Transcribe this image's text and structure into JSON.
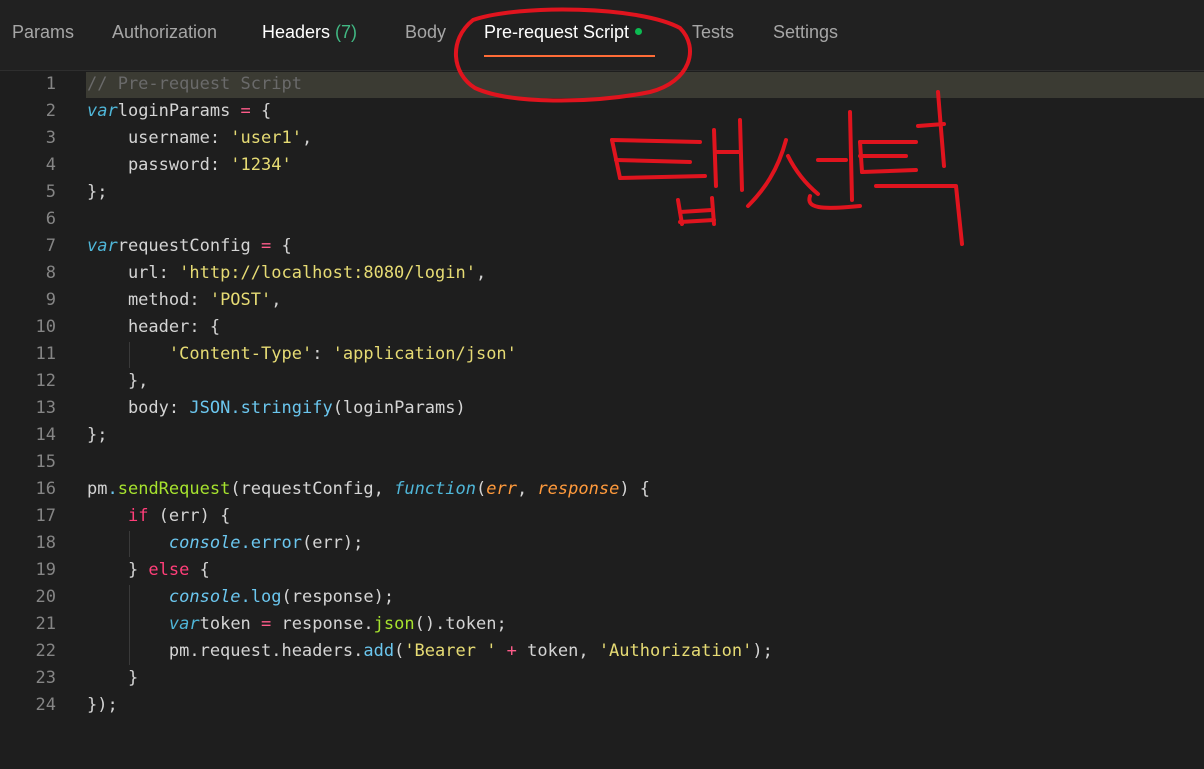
{
  "tabs": [
    {
      "label": "Params",
      "count": "",
      "dot": false,
      "active": false
    },
    {
      "label": "Authorization",
      "count": "",
      "dot": false,
      "active": false
    },
    {
      "label": "Headers ",
      "count": "(7)",
      "dot": false,
      "active": false
    },
    {
      "label": "Body",
      "count": "",
      "dot": false,
      "active": false
    },
    {
      "label": "Pre-request Script",
      "count": "",
      "dot": true,
      "active": true
    },
    {
      "label": "Tests",
      "count": "",
      "dot": false,
      "active": false
    },
    {
      "label": "Settings",
      "count": "",
      "dot": false,
      "active": false
    }
  ],
  "accent_color": "#ff6c37",
  "status_dot_color": "#0cbb52",
  "line_numbers": [
    "1",
    "2",
    "3",
    "4",
    "5",
    "6",
    "7",
    "8",
    "9",
    "10",
    "11",
    "12",
    "13",
    "14",
    "15",
    "16",
    "17",
    "18",
    "19",
    "20",
    "21",
    "22",
    "23",
    "24"
  ],
  "code": [
    [
      [
        "cm",
        "// Pre-request Script"
      ]
    ],
    [
      [
        "kw",
        "var"
      ],
      [
        "",
        "loginParams "
      ],
      [
        "op",
        "="
      ],
      [
        "",
        " {"
      ]
    ],
    [
      [
        "",
        "    username: "
      ],
      [
        "str",
        "'user1'"
      ],
      [
        "",
        ","
      ]
    ],
    [
      [
        "",
        "    password: "
      ],
      [
        "str",
        "'1234'"
      ]
    ],
    [
      [
        "",
        "};"
      ]
    ],
    [],
    [
      [
        "kw",
        "var"
      ],
      [
        "",
        "requestConfig "
      ],
      [
        "op",
        "="
      ],
      [
        "",
        " {"
      ]
    ],
    [
      [
        "",
        "    url: "
      ],
      [
        "str",
        "'http://localhost:8080/login'"
      ],
      [
        "",
        ","
      ]
    ],
    [
      [
        "",
        "    method: "
      ],
      [
        "str",
        "'POST'"
      ],
      [
        "",
        ","
      ]
    ],
    [
      [
        "",
        "    header: {"
      ]
    ],
    [
      [
        "",
        "        "
      ],
      [
        "str",
        "'Content-Type'"
      ],
      [
        "",
        ": "
      ],
      [
        "str",
        "'application/json'"
      ]
    ],
    [
      [
        "",
        "    },"
      ]
    ],
    [
      [
        "",
        "    body: "
      ],
      [
        "ob",
        "JSON"
      ],
      [
        "ob",
        "."
      ],
      [
        "ob",
        "stringify"
      ],
      [
        "",
        "(loginParams)"
      ]
    ],
    [
      [
        "",
        "};"
      ]
    ],
    [],
    [
      [
        "",
        "pm"
      ],
      [
        "ob",
        "."
      ],
      [
        "fn",
        "sendRequest"
      ],
      [
        "",
        "(requestConfig, "
      ],
      [
        "kw",
        "function"
      ],
      [
        "",
        "("
      ],
      [
        "prm",
        "err"
      ],
      [
        "",
        ", "
      ],
      [
        "prm",
        "response"
      ],
      [
        "",
        ") {"
      ]
    ],
    [
      [
        "",
        "    "
      ],
      [
        "ctl",
        "if"
      ],
      [
        "",
        " (err) {"
      ]
    ],
    [
      [
        "",
        "        "
      ],
      [
        "cs",
        "console"
      ],
      [
        "ob",
        ".error"
      ],
      [
        "",
        "(err);"
      ]
    ],
    [
      [
        "",
        "    } "
      ],
      [
        "ctl",
        "else"
      ],
      [
        "",
        " {"
      ]
    ],
    [
      [
        "",
        "        "
      ],
      [
        "cs",
        "console"
      ],
      [
        "ob",
        ".log"
      ],
      [
        "",
        "(response);"
      ]
    ],
    [
      [
        "",
        "        "
      ],
      [
        "kw",
        "var"
      ],
      [
        "",
        "token "
      ],
      [
        "op",
        "="
      ],
      [
        "",
        " response."
      ],
      [
        "fn",
        "json"
      ],
      [
        "",
        "().token;"
      ]
    ],
    [
      [
        "",
        "        pm.request.headers."
      ],
      [
        "ob",
        "add"
      ],
      [
        "",
        "("
      ],
      [
        "str",
        "'Bearer '"
      ],
      [
        "op",
        " +"
      ],
      [
        "",
        " token, "
      ],
      [
        "str",
        "'Authorization'"
      ],
      [
        "",
        ");"
      ]
    ],
    [
      [
        "",
        "    }"
      ]
    ],
    [
      [
        "",
        "});"
      ]
    ]
  ],
  "annotation_text": "탭선택",
  "annotation_color": "#e0141e"
}
